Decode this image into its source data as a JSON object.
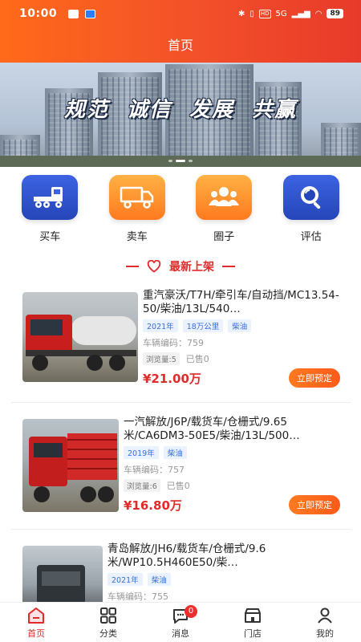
{
  "status_bar": {
    "time": "10:00",
    "network": "5G",
    "battery": "89"
  },
  "header": {
    "title": "首页"
  },
  "banner": {
    "slogan": [
      "规范",
      "诚信",
      "发展",
      "共赢"
    ],
    "active_dot": 1
  },
  "categories": [
    {
      "label": "买车",
      "icon": "truck-tractor-icon"
    },
    {
      "label": "卖车",
      "icon": "cargo-truck-icon"
    },
    {
      "label": "圈子",
      "icon": "people-group-icon"
    },
    {
      "label": "评估",
      "icon": "magnifier-icon"
    }
  ],
  "section": {
    "title": "最新上架",
    "icon": "heart-icon"
  },
  "listings": [
    {
      "name": "重汽豪沃/T7H/牵引车/自动挡/MC13.54-50/柴油/13L/540…",
      "tags": [
        "2021年",
        "18万公里",
        "柴油"
      ],
      "code_label": "车辆编码：",
      "code": "759",
      "views": "浏览量:5",
      "sold": "已售0",
      "price": "¥21.00万",
      "button": "立即预定"
    },
    {
      "name": "一汽解放/J6P/载货车/仓栅式/9.65米/CA6DM3-50E5/柴油/13L/500…",
      "tags": [
        "2019年",
        "柴油"
      ],
      "code_label": "车辆编码：",
      "code": "757",
      "views": "浏览量:6",
      "sold": "已售0",
      "price": "¥16.80万",
      "button": "立即预定"
    },
    {
      "name": "青岛解放/JH6/载货车/仓栅式/9.6米/WP10.5H460E50/柴…",
      "tags": [
        "2021年",
        "柴油"
      ],
      "code_label": "车辆编码：",
      "code": "755"
    }
  ],
  "tabbar": {
    "items": [
      {
        "label": "首页",
        "icon": "home-icon",
        "active": true
      },
      {
        "label": "分类",
        "icon": "grid-icon"
      },
      {
        "label": "消息",
        "icon": "message-icon",
        "badge": "0"
      },
      {
        "label": "门店",
        "icon": "store-icon"
      },
      {
        "label": "我的",
        "icon": "user-icon"
      }
    ]
  },
  "colors": {
    "accent": "#e12b2b",
    "header_start": "#ff6a1a",
    "button": "#ff5a1a",
    "tag": "#3a6fd8"
  }
}
